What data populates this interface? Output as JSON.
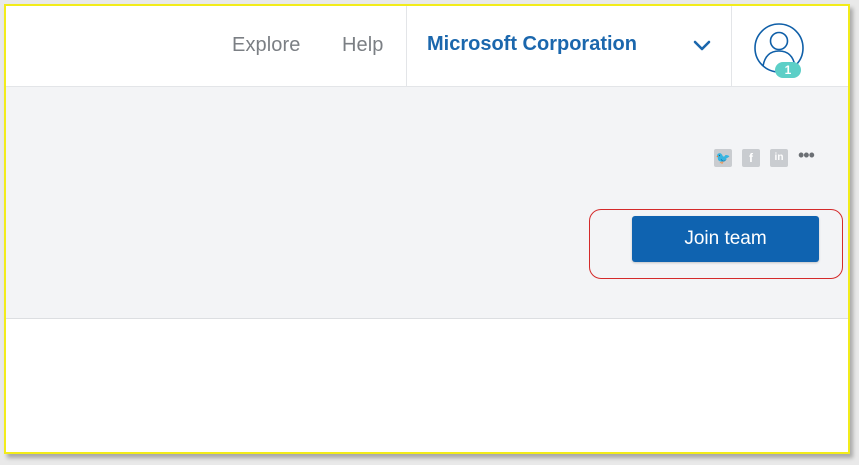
{
  "nav": {
    "explore_label": "Explore",
    "help_label": "Help",
    "org_name": "Microsoft Corporation",
    "org_dropdown_icon": "chevron-down-icon",
    "notification_count": "1"
  },
  "share": {
    "icons": [
      "twitter-icon",
      "facebook-icon",
      "linkedin-icon",
      "more-icon"
    ],
    "twitter_glyph": "🐦",
    "facebook_glyph": "f",
    "linkedin_glyph": "in",
    "more_glyph": "•••"
  },
  "actions": {
    "join_label": "Join team"
  },
  "colors": {
    "brand_blue": "#0f63b0",
    "org_link": "#1b67ad",
    "badge": "#5ccfc7",
    "highlight": "#d42a2a",
    "frame_border": "#f2ec1a"
  }
}
